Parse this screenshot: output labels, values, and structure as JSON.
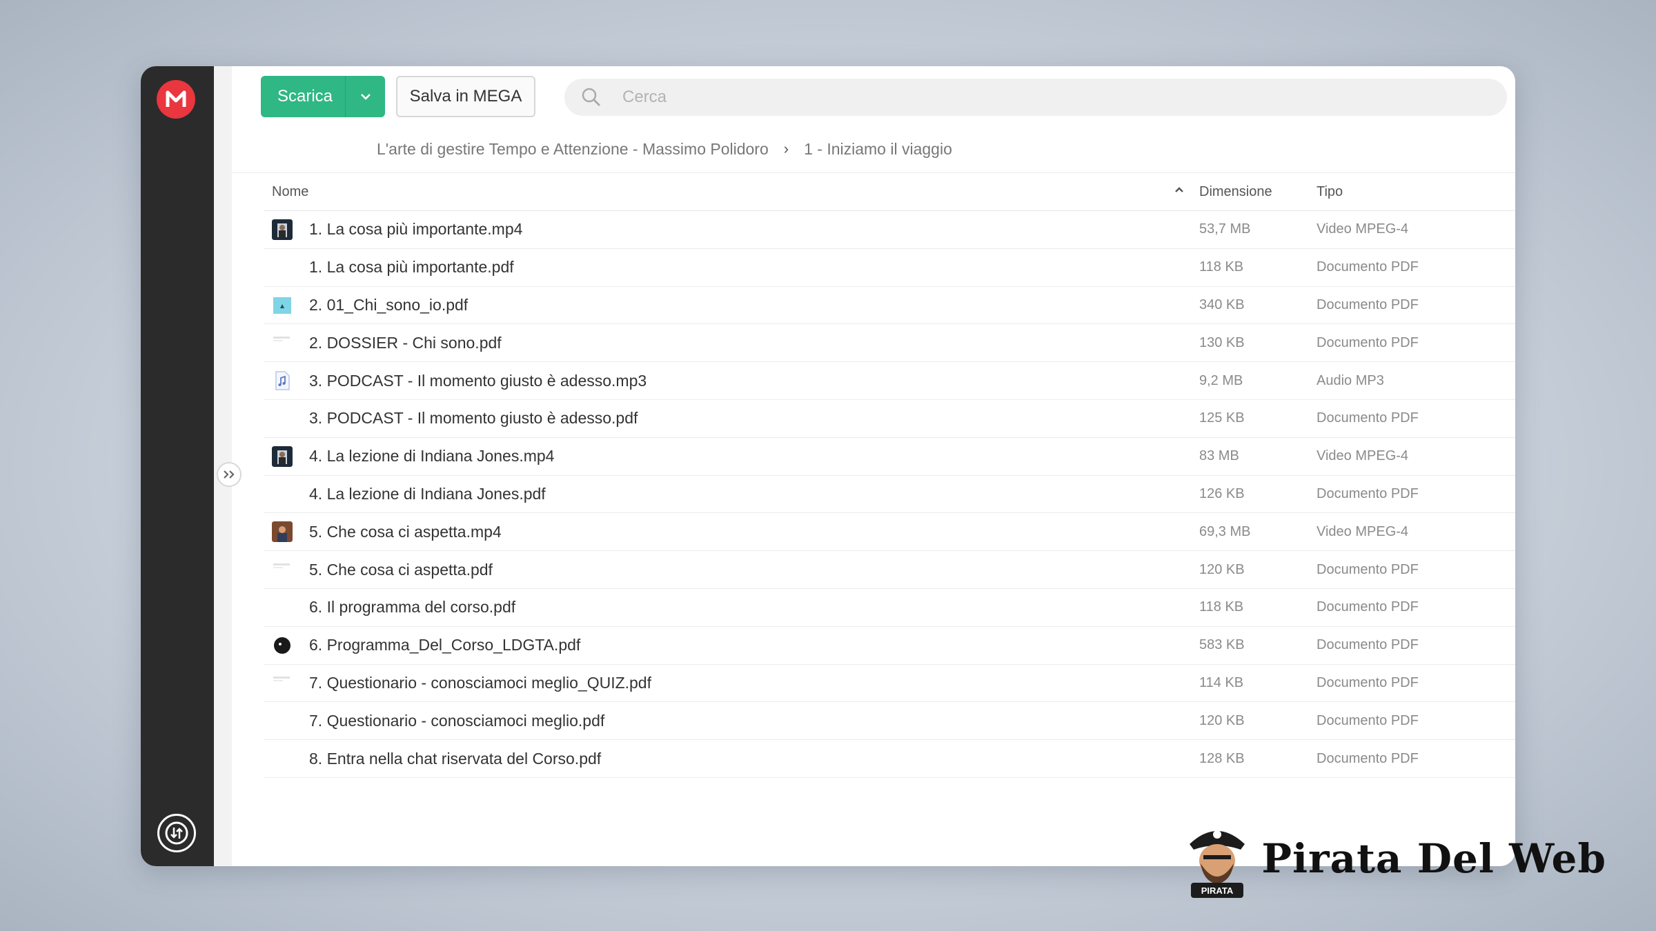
{
  "toolbar": {
    "download_label": "Scarica",
    "save_label": "Salva in MEGA",
    "search_placeholder": "Cerca"
  },
  "breadcrumb": {
    "parent": "L'arte di gestire Tempo e Attenzione - Massimo Polidoro",
    "current": "1 - Iniziamo il viaggio"
  },
  "table": {
    "columns": {
      "name": "Nome",
      "size": "Dimensione",
      "type": "Tipo"
    },
    "sort": "name-ascending",
    "rows": [
      {
        "icon": "video-thumbnail",
        "name": "1. La cosa più importante.mp4",
        "size": "53,7 MB",
        "type": "Video MPEG-4"
      },
      {
        "icon": "none",
        "name": "1. La cosa più importante.pdf",
        "size": "118 KB",
        "type": "Documento PDF"
      },
      {
        "icon": "pdf-thumbnail-blue",
        "name": "2. 01_Chi_sono_io.pdf",
        "size": "340 KB",
        "type": "Documento PDF"
      },
      {
        "icon": "pdf-thumbnail-faint",
        "name": "2. DOSSIER - Chi sono.pdf",
        "size": "130 KB",
        "type": "Documento PDF"
      },
      {
        "icon": "audio-file-icon",
        "name": "3. PODCAST - Il momento giusto è adesso.mp3",
        "size": "9,2 MB",
        "type": "Audio MP3"
      },
      {
        "icon": "none",
        "name": "3. PODCAST - Il momento giusto è adesso.pdf",
        "size": "125 KB",
        "type": "Documento PDF"
      },
      {
        "icon": "video-thumbnail",
        "name": "4. La lezione di Indiana Jones.mp4",
        "size": "83 MB",
        "type": "Video MPEG-4"
      },
      {
        "icon": "none",
        "name": "4. La lezione di Indiana Jones.pdf",
        "size": "126 KB",
        "type": "Documento PDF"
      },
      {
        "icon": "video-thumbnail-warm",
        "name": "5. Che cosa ci aspetta.mp4",
        "size": "69,3 MB",
        "type": "Video MPEG-4"
      },
      {
        "icon": "pdf-thumbnail-faint",
        "name": "5. Che cosa ci aspetta.pdf",
        "size": "120 KB",
        "type": "Documento PDF"
      },
      {
        "icon": "none",
        "name": "6. Il programma del corso.pdf",
        "size": "118 KB",
        "type": "Documento PDF"
      },
      {
        "icon": "pdf-thumbnail-dark",
        "name": "6. Programma_Del_Corso_LDGTA.pdf",
        "size": "583 KB",
        "type": "Documento PDF"
      },
      {
        "icon": "pdf-thumbnail-faint",
        "name": "7. Questionario - conosciamoci meglio_QUIZ.pdf",
        "size": "114 KB",
        "type": "Documento PDF"
      },
      {
        "icon": "none",
        "name": "7. Questionario - conosciamoci meglio.pdf",
        "size": "120 KB",
        "type": "Documento PDF"
      },
      {
        "icon": "none",
        "name": "8. Entra nella chat riservata del Corso.pdf",
        "size": "128 KB",
        "type": "Documento PDF"
      }
    ]
  },
  "watermark": {
    "text": "Pirata Del Web",
    "badge_text": "PIRATA"
  },
  "colors": {
    "accent_green": "#2fb784",
    "mega_red": "#e9363f",
    "sidebar": "#2b2b2b"
  }
}
